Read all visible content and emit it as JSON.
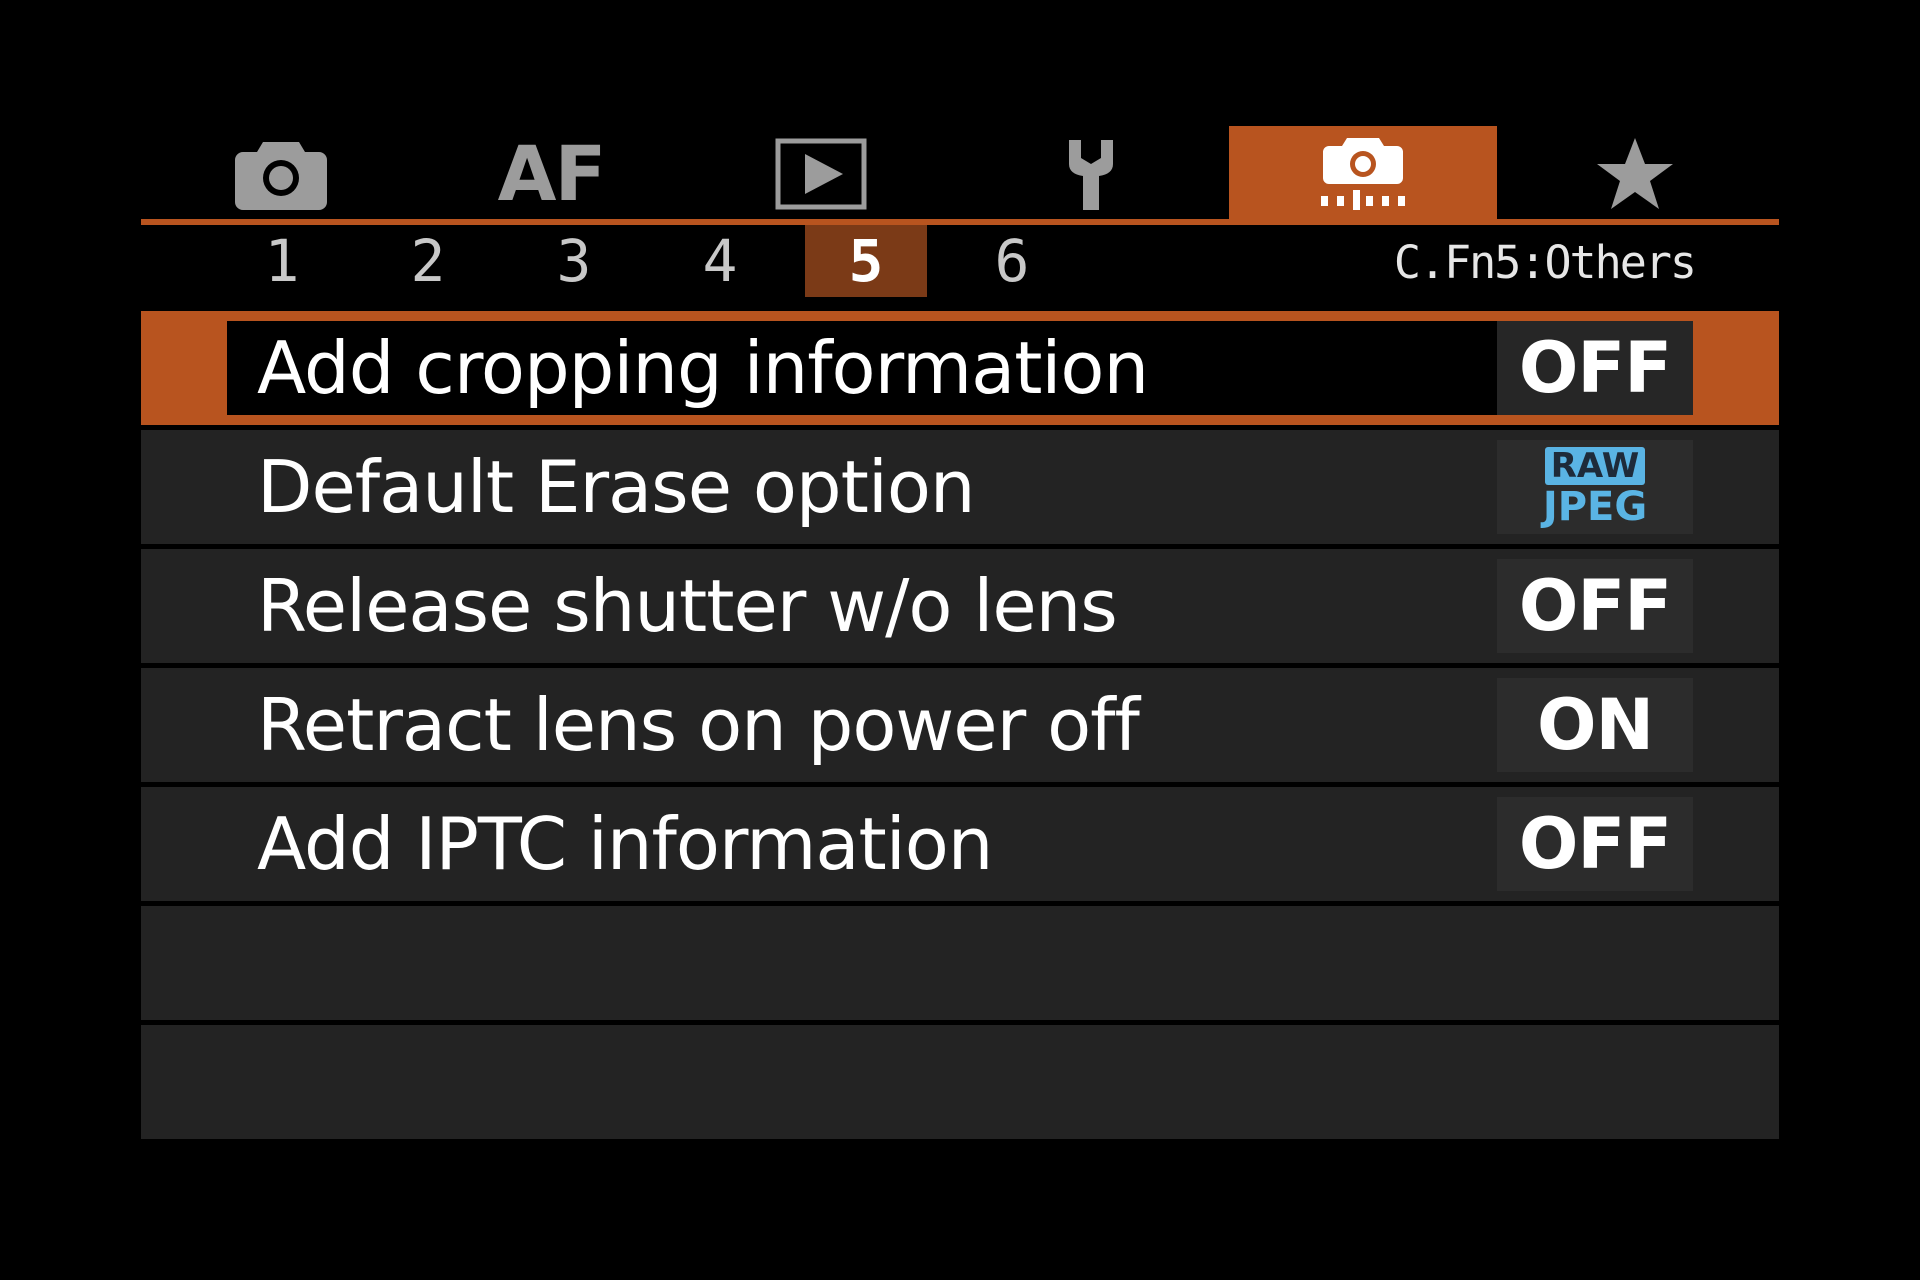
{
  "tabs": [
    {
      "name": "shooting",
      "icon": "camera-icon"
    },
    {
      "name": "af",
      "label": "AF"
    },
    {
      "name": "playback",
      "icon": "playback-icon"
    },
    {
      "name": "setup",
      "icon": "wrench-icon"
    },
    {
      "name": "custom-functions",
      "icon": "custom-functions-icon",
      "active": true
    },
    {
      "name": "my-menu",
      "icon": "star-icon"
    }
  ],
  "subtabs": [
    "1",
    "2",
    "3",
    "4",
    "5",
    "6"
  ],
  "active_subtab": "5",
  "section_title": "C.Fn5:Others",
  "items": [
    {
      "label": "Add cropping information",
      "value": "OFF",
      "selected": true
    },
    {
      "label": "Default Erase option",
      "value_raw": "RAW",
      "value_jpeg": "JPEG"
    },
    {
      "label": "Release shutter w/o lens",
      "value": "OFF"
    },
    {
      "label": "Retract lens on power off",
      "value": "ON"
    },
    {
      "label": "Add IPTC information",
      "value": "OFF"
    }
  ],
  "colors": {
    "accent": "#b8541f",
    "active_subtab": "#7b3a17",
    "row_bg": "#232323",
    "format_badge": "#5ab4e4"
  }
}
